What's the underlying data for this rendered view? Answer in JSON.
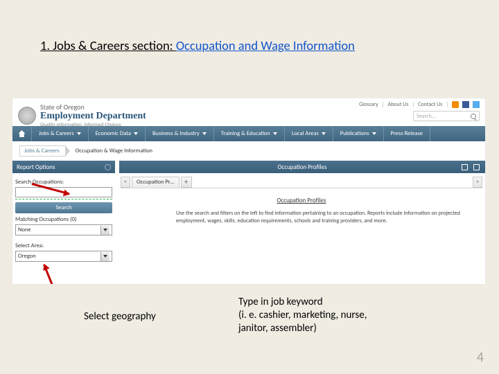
{
  "slide": {
    "title_prefix": "1. Jobs & Careers section: ",
    "title_link": "Occupation and Wage Information",
    "page_number": "4"
  },
  "util": {
    "glossary": "Glossary",
    "about": "About Us",
    "contact": "Contact Us"
  },
  "global_search_placeholder": "Search…",
  "logo": {
    "line1": "State of Oregon",
    "line2": "Employment Department",
    "line3": "Quality Information, Informed Choices"
  },
  "nav": {
    "items": [
      {
        "label": "Jobs & Careers"
      },
      {
        "label": "Economic Data"
      },
      {
        "label": "Business & Industry"
      },
      {
        "label": "Training & Education"
      },
      {
        "label": "Local Areas"
      },
      {
        "label": "Publications"
      },
      {
        "label": "Press Release"
      }
    ]
  },
  "breadcrumb": {
    "first": "Jobs & Careers",
    "second": "Occupation & Wage Information"
  },
  "panels": {
    "left_header": "Report Options",
    "right_header": "Occupation Profiles"
  },
  "sidebar": {
    "search_label": "Search Occupations:",
    "search_value": "",
    "search_button": "Search",
    "matching_label": "Matching Occupations (0)",
    "matching_value": "None",
    "area_label": "Select Area:",
    "area_value": "Oregon"
  },
  "tabs": {
    "active": "Occupation Pr…"
  },
  "content": {
    "heading": "Occupation Profiles",
    "body": "Use the search and filters on the left to find information pertaining to an occupation. Reports include information on projected employment, wages, skills, education requirements, schools and training providers, and more."
  },
  "annotations": {
    "left": "Select geography",
    "right_l1": "Type in job keyword",
    "right_l2": "(i. e.  cashier, marketing, nurse,",
    "right_l3": "janitor, assembler)"
  }
}
